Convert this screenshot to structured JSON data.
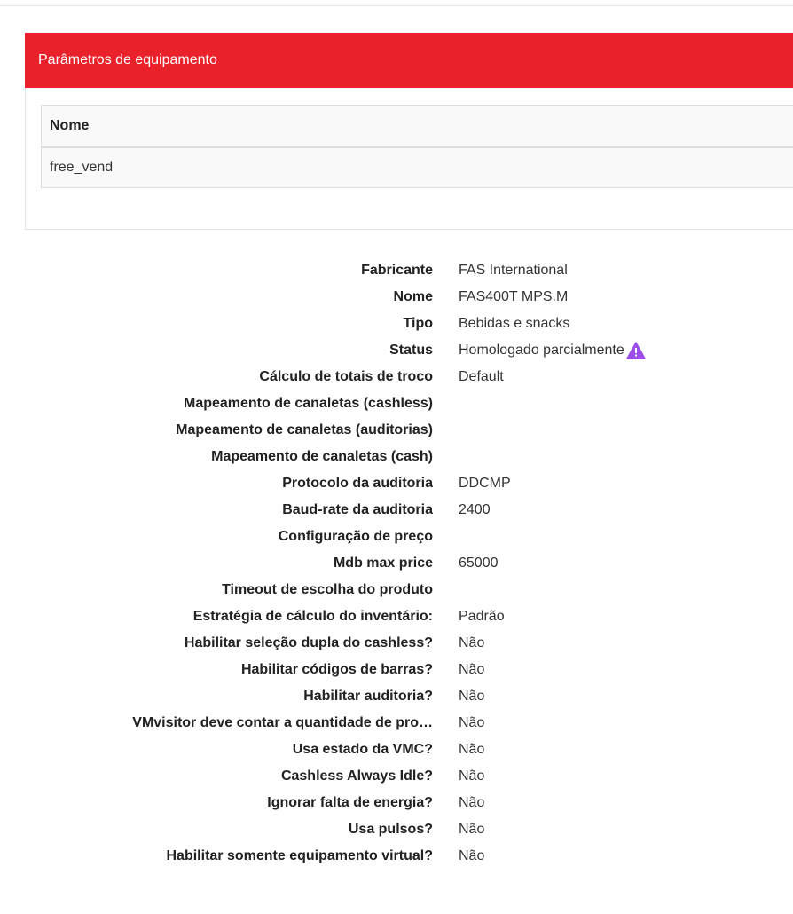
{
  "panel": {
    "title": "Parâmetros de equipamento",
    "header_color": "#e8212b",
    "table": {
      "columns": [
        "Nome"
      ],
      "rows": [
        [
          "free_vend"
        ]
      ]
    }
  },
  "details": [
    {
      "label": "Fabricante",
      "value": "FAS International"
    },
    {
      "label": "Nome",
      "value": "FAS400T MPS.M"
    },
    {
      "label": "Tipo",
      "value": "Bebidas e snacks"
    },
    {
      "label": "Status",
      "value": "Homologado parcialmente",
      "icon": "warning-icon",
      "icon_color": "#9b4fe8"
    },
    {
      "label": "Cálculo de totais de troco",
      "value": "Default"
    },
    {
      "label": "Mapeamento de canaletas (cashless)",
      "value": ""
    },
    {
      "label": "Mapeamento de canaletas (auditorias)",
      "value": ""
    },
    {
      "label": "Mapeamento de canaletas (cash)",
      "value": ""
    },
    {
      "label": "Protocolo da auditoria",
      "value": "DDCMP"
    },
    {
      "label": "Baud-rate da auditoria",
      "value": "2400"
    },
    {
      "label": "Configuração de preço",
      "value": ""
    },
    {
      "label": "Mdb max price",
      "value": "65000"
    },
    {
      "label": "Timeout de escolha do produto",
      "value": ""
    },
    {
      "label": "Estratégia de cálculo do inventário:",
      "value": "Padrão"
    },
    {
      "label": "Habilitar seleção dupla do cashless?",
      "value": "Não"
    },
    {
      "label": "Habilitar códigos de barras?",
      "value": "Não"
    },
    {
      "label": "Habilitar auditoria?",
      "value": "Não"
    },
    {
      "label": "VMvisitor deve contar a quantidade de pro…",
      "value": "Não"
    },
    {
      "label": "Usa estado da VMC?",
      "value": "Não"
    },
    {
      "label": "Cashless Always Idle?",
      "value": "Não"
    },
    {
      "label": "Ignorar falta de energia?",
      "value": "Não"
    },
    {
      "label": "Usa pulsos?",
      "value": "Não"
    },
    {
      "label": "Habilitar somente equipamento virtual?",
      "value": "Não"
    }
  ]
}
